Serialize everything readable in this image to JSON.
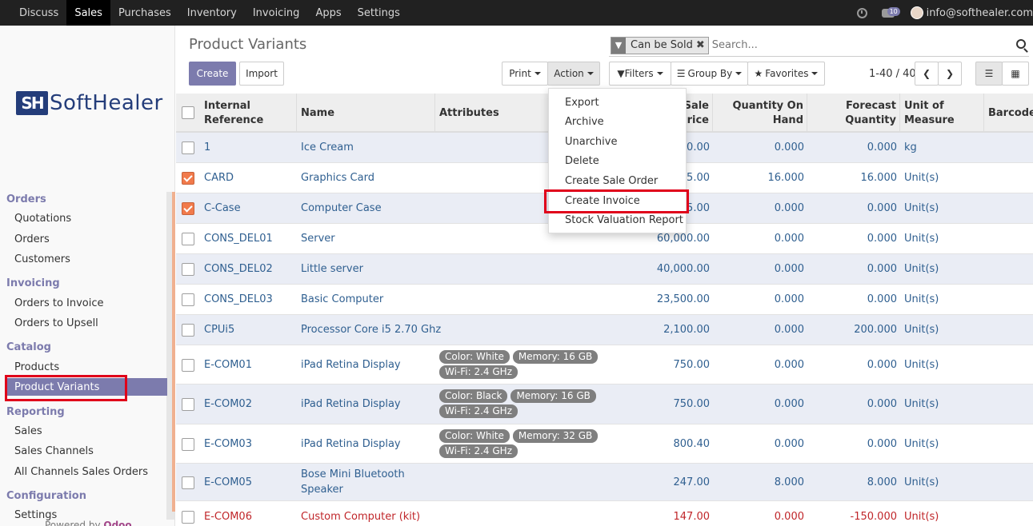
{
  "topbar": {
    "menus": [
      "Discuss",
      "Sales",
      "Purchases",
      "Inventory",
      "Invoicing",
      "Apps",
      "Settings"
    ],
    "active_menu": "Sales",
    "chat_badge": "10",
    "user": "info@softhealer.com"
  },
  "sidebar": {
    "logo_mark": "SH",
    "logo_text": "SoftHealer",
    "sections": [
      {
        "title": "Orders",
        "items": [
          "Quotations",
          "Orders",
          "Customers"
        ]
      },
      {
        "title": "Invoicing",
        "items": [
          "Orders to Invoice",
          "Orders to Upsell"
        ]
      },
      {
        "title": "Catalog",
        "items": [
          "Products",
          "Product Variants"
        ]
      },
      {
        "title": "Reporting",
        "items": [
          "Sales",
          "Sales Channels",
          "All Channels Sales Orders"
        ]
      },
      {
        "title": "Configuration",
        "items": [
          "Settings"
        ]
      }
    ],
    "active_item": "Product Variants",
    "powered_by": "Powered by",
    "powered_brand": "Odoo"
  },
  "page": {
    "title": "Product Variants",
    "create": "Create",
    "import": "Import",
    "print": "Print",
    "action": "Action",
    "filters": "Filters",
    "group_by": "Group By",
    "favorites": "Favorites",
    "pager": "1-40 / 40"
  },
  "search": {
    "facet": "Can be Sold",
    "placeholder": "Search..."
  },
  "action_menu": [
    "Export",
    "Archive",
    "Unarchive",
    "Delete",
    "Create Sale Order",
    "Create Invoice",
    "Stock Valuation Report"
  ],
  "table": {
    "headers": {
      "internal_ref": [
        "Internal",
        "Reference"
      ],
      "name": "Name",
      "attributes": "Attributes",
      "sale_price": [
        "Sale",
        "Price"
      ],
      "qty_on_hand": [
        "Quantity On",
        "Hand"
      ],
      "forecast": [
        "Forecast",
        "Quantity"
      ],
      "uom": [
        "Unit of",
        "Measure"
      ],
      "barcode": "Barcode"
    },
    "rows": [
      {
        "ref": "1",
        "name": "Ice Cream",
        "tags": [],
        "price": "100.00",
        "onhand": "0.000",
        "forecast": "0.000",
        "uom": "kg",
        "checked": false
      },
      {
        "ref": "CARD",
        "name": "Graphics Card",
        "tags": [],
        "price": "885.00",
        "onhand": "16.000",
        "forecast": "16.000",
        "uom": "Unit(s)",
        "checked": true
      },
      {
        "ref": "C-Case",
        "name": "Computer Case",
        "tags": [],
        "price": "25.00",
        "onhand": "0.000",
        "forecast": "0.000",
        "uom": "Unit(s)",
        "checked": true
      },
      {
        "ref": "CONS_DEL01",
        "name": "Server",
        "tags": [],
        "price": "60,000.00",
        "onhand": "0.000",
        "forecast": "0.000",
        "uom": "Unit(s)",
        "checked": false
      },
      {
        "ref": "CONS_DEL02",
        "name": "Little server",
        "tags": [],
        "price": "40,000.00",
        "onhand": "0.000",
        "forecast": "0.000",
        "uom": "Unit(s)",
        "checked": false
      },
      {
        "ref": "CONS_DEL03",
        "name": "Basic Computer",
        "tags": [],
        "price": "23,500.00",
        "onhand": "0.000",
        "forecast": "0.000",
        "uom": "Unit(s)",
        "checked": false
      },
      {
        "ref": "CPUi5",
        "name": "Processor Core i5 2.70 Ghz",
        "tags": [],
        "price": "2,100.00",
        "onhand": "0.000",
        "forecast": "200.000",
        "uom": "Unit(s)",
        "checked": false
      },
      {
        "ref": "E-COM01",
        "name": "iPad Retina Display",
        "tags": [
          "Color: White",
          "Memory: 16 GB",
          "Wi-Fi: 2.4 GHz"
        ],
        "price": "750.00",
        "onhand": "0.000",
        "forecast": "0.000",
        "uom": "Unit(s)",
        "checked": false
      },
      {
        "ref": "E-COM02",
        "name": "iPad Retina Display",
        "tags": [
          "Color: Black",
          "Memory: 16 GB",
          "Wi-Fi: 2.4 GHz"
        ],
        "price": "750.00",
        "onhand": "0.000",
        "forecast": "0.000",
        "uom": "Unit(s)",
        "checked": false
      },
      {
        "ref": "E-COM03",
        "name": "iPad Retina Display",
        "tags": [
          "Color: White",
          "Memory: 32 GB",
          "Wi-Fi: 2.4 GHz"
        ],
        "price": "800.40",
        "onhand": "0.000",
        "forecast": "0.000",
        "uom": "Unit(s)",
        "checked": false
      },
      {
        "ref": "E-COM05",
        "name": "Bose Mini Bluetooth Speaker",
        "name_lines": [
          "Bose Mini Bluetooth",
          "Speaker"
        ],
        "tags": [],
        "price": "247.00",
        "onhand": "8.000",
        "forecast": "8.000",
        "uom": "Unit(s)",
        "checked": false
      },
      {
        "ref": "E-COM06",
        "name": "Custom Computer (kit)",
        "tags": [],
        "price": "147.00",
        "onhand": "0.000",
        "forecast": "-150.000",
        "uom": "Unit(s)",
        "checked": false,
        "warning": true
      }
    ]
  },
  "colors": {
    "brand": "#7c7bad",
    "link": "#2f5f90",
    "checkbox_checked": "#f17a4b",
    "highlight_box": "#e0001a",
    "warning_row": "#c0262a"
  }
}
